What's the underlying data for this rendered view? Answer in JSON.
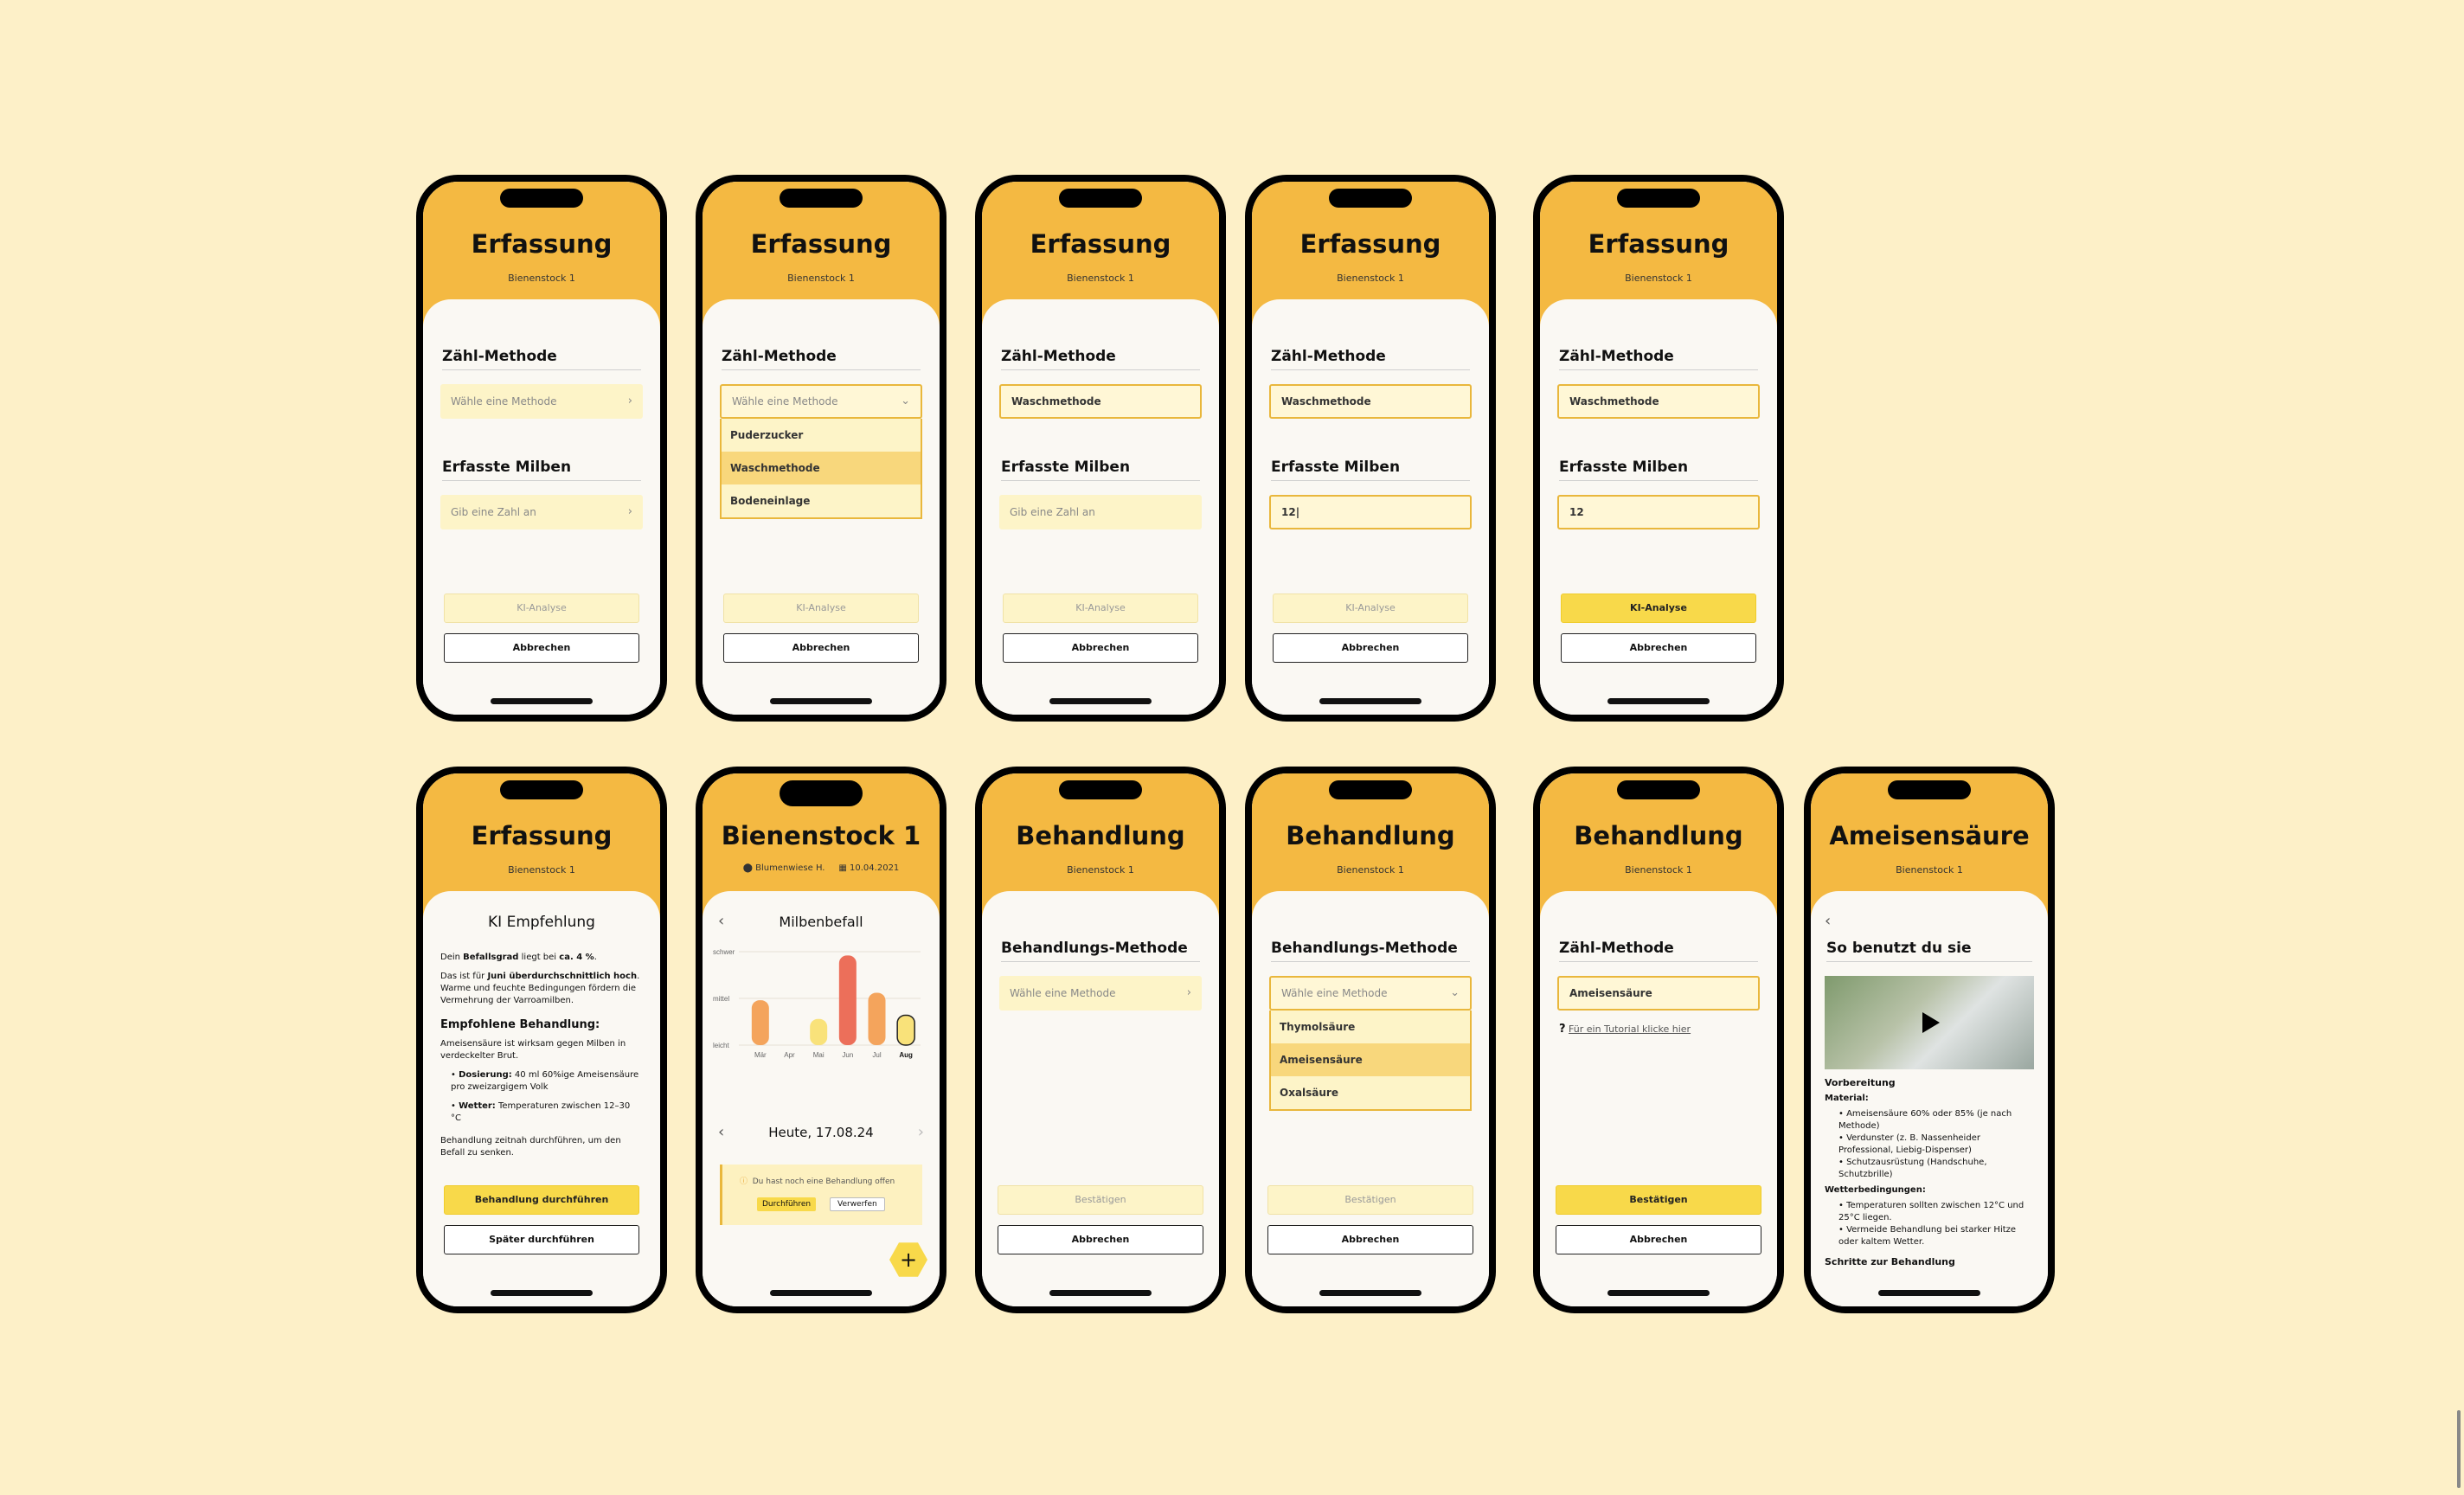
{
  "common": {
    "cancel": "Abbrechen",
    "hive": "Bienenstock 1",
    "title_erfassung": "Erfassung",
    "title_behandlung": "Behandlung",
    "count_method": "Zähl-Methode",
    "mites": "Erfasste Milben",
    "choose_method": "Wähle eine Methode",
    "enter_number": "Gib eine Zahl an",
    "ai_analysis": "KI-Analyse",
    "treat_method": "Behandlungs-Methode",
    "confirm": "Bestätigen"
  },
  "count_options": [
    "Puderzucker",
    "Waschmethode",
    "Bodeneinlage"
  ],
  "selected_count_method": "Waschmethode",
  "mite_typing": "12|",
  "mite_value": "12",
  "treatment_options": [
    "Thymolsäure",
    "Ameisensäure",
    "Oxalsäure"
  ],
  "selected_treatment": "Ameisensäure",
  "ki": {
    "heading": "KI Empfehlung",
    "p1_pre": "Dein ",
    "p1_b1": "Befallsgrad",
    "p1_mid": " liegt bei ",
    "p1_b2": "ca. 4 %",
    "p1_post": ".",
    "p2_pre": "Das ist für ",
    "p2_b": "Juni überdurchschnittlich hoch",
    "p2_post": ". Warme und feuchte Bedingungen fördern die Vermehrung der Varroamilben.",
    "rec_title": "Empfohlene Behandlung:",
    "rec_text": "Ameisensäure ist wirksam gegen Milben in verdeckelter Brut.",
    "b1_label": "Dosierung:",
    "b1_text": " 40 ml 60%ige Ameisensäure pro zweizargigem Volk",
    "b2_label": "Wetter:",
    "b2_text": " Temperaturen zwischen 12–30 °C",
    "closing": "Behandlung zeitnah durchführen, um den Befall zu senken.",
    "btn_primary": "Behandlung durchführen",
    "btn_secondary": "Später durchführen"
  },
  "hive_screen": {
    "title": "Bienenstock 1",
    "location": "Blumenwiese H.",
    "date": "10.04.2021",
    "chart_title": "Milbenbefall",
    "today": "Heute, 17.08.24",
    "notice": "Du hast noch eine Behandlung offen",
    "btn_do": "Durchführen",
    "btn_discard": "Verwerfen",
    "fab": "+"
  },
  "chart_data": {
    "type": "bar",
    "categories": [
      "Mär",
      "Apr",
      "Mai",
      "Jun",
      "Jul",
      "Aug"
    ],
    "values": [
      1.2,
      0,
      0.7,
      2.4,
      1.4,
      0.8
    ],
    "y_ticks": [
      "leicht",
      "mittel",
      "schwer"
    ],
    "ylim": [
      0,
      2.5
    ],
    "highlight": "Aug",
    "colors": {
      "low": "#f9e27a",
      "high": "#ec6f5a",
      "mid": "#f4a45c"
    }
  },
  "tutorial_link": "Für ein Tutorial klicke hier",
  "acid_screen": {
    "title": "Ameisensäure",
    "heading": "So benutzt du sie",
    "prep": "Vorbereitung",
    "material": "Material:",
    "materials": [
      "Ameisensäure 60% oder 85% (je nach Methode)",
      "Verdunster (z. B. Nassenheider Professional, Liebig-Dispenser)",
      "Schutzausrüstung (Handschuhe, Schutzbrille)"
    ],
    "weather": "Wetterbedingungen:",
    "weather_items": [
      "Temperaturen sollten zwischen 12°C und 25°C liegen.",
      "Vermeide Behandlung bei starker Hitze oder kaltem Wetter."
    ],
    "steps": "Schritte zur Behandlung"
  }
}
